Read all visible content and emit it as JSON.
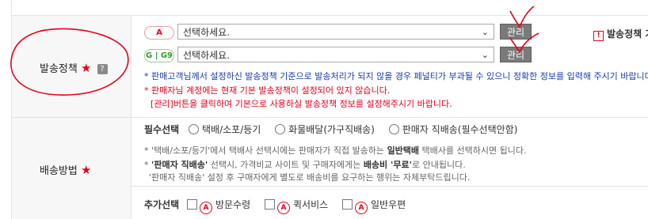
{
  "shipping_policy": {
    "label": "발송정책",
    "required_mark": "★",
    "help_badge": "?",
    "rows": [
      {
        "badge": "A",
        "select_value": "선택하세요.",
        "manage_label": "관리"
      },
      {
        "badge": "G | G9",
        "select_value": "선택하세요.",
        "manage_label": "관리"
      }
    ],
    "right_notice": "발송정책 가",
    "notice_icon": "!",
    "note1": "* 판매고객님께서 설정하신 발송정책 기준으로 발송처리가 되지 않을 경우 페널티가 부과될 수 있으니 정확한 정보를 입력해 주시기 바랍니다.",
    "note2": "* 판매자님 계정에는 현재 기본 발송정책이 설정되어 있지 않습니다.",
    "note3": "[관리]버튼을 클릭하여 기본으로 사용하실 발송정책 정보를 설정해주시기 바랍니다."
  },
  "delivery_method": {
    "label": "배송방법",
    "required_mark": "★",
    "required_title": "필수선택",
    "options": [
      "택배/소포/등기",
      "화물배달(가구직배송)",
      "판매자 직배송(필수선택안함)"
    ],
    "info1_prefix": "* '택배/소포/등기'에서 택배사 선택시에는 판매자가 직접 발송하는 ",
    "info1_bold": "일반택배",
    "info1_suffix": " 택배사를 선택하시면 됩니다.",
    "info2_prefix": "* ",
    "info2_bold1": "'판매자 직배송'",
    "info2_mid": " 선택시, 가격비교 사이트 및 구매자에게는 ",
    "info2_bold2": "배송비 '무료'",
    "info2_suffix": "로 안내됩니다.",
    "info3": "'판매자 직배송' 설정 후 구매자에게 별도로 배송비를 요구하는 행위는 자체부탁드립니다.",
    "additional_title": "추가선택",
    "additional_badge": "A",
    "additional_options": [
      "방문수령",
      "퀵서비스",
      "일반우편"
    ]
  }
}
